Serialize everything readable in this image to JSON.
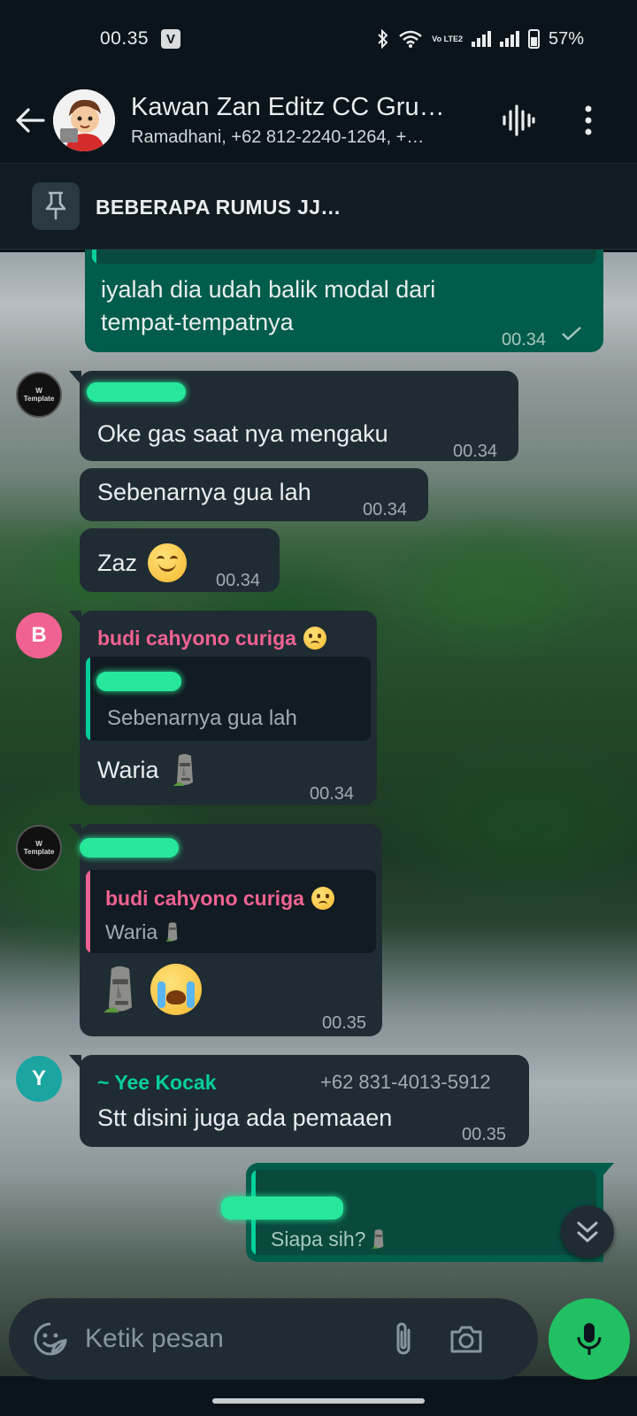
{
  "status": {
    "time": "00.35",
    "app_badge": "V",
    "volte": "Vo LTE2",
    "battery": "57%"
  },
  "header": {
    "title": "Kawan Zan Editz CC Gru…",
    "subtitle": "Ramadhani, +62 812-2240-1264, +…"
  },
  "pinned": {
    "text": "BEBERAPA RUMUS JJ…"
  },
  "messages": {
    "m0": {
      "text1": "iyalah dia udah balik modal dari",
      "text2": "tempat-tempatnya",
      "time": "00.34"
    },
    "m1": {
      "text": "Oke gas saat nya mengaku",
      "time": "00.34"
    },
    "m2": {
      "text": "Sebenarnya gua lah",
      "time": "00.34"
    },
    "m3": {
      "text": "Zaz",
      "time": "00.34"
    },
    "m4": {
      "avatar_letter": "B",
      "sender": "budi cahyono curiga",
      "quote_text": "Sebenarnya gua lah",
      "text": "Waria",
      "time": "00.34"
    },
    "m5": {
      "quote_sender": "budi cahyono curiga",
      "quote_text": "Waria",
      "time": "00.35"
    },
    "m6": {
      "avatar_letter": "Y",
      "sender": "~ Yee Kocak",
      "phone": "+62 831-4013-5912",
      "text": "Stt disini juga ada pemaaen",
      "time": "00.35"
    },
    "m7": {
      "quote_text": "Siapa sih?"
    }
  },
  "composer": {
    "placeholder": "Ketik pesan"
  },
  "colors": {
    "incoming": "#202c33",
    "outgoing": "#005c4b",
    "budi": "#f06292",
    "yee": "#06cf9c",
    "mic": "#21c063"
  },
  "icons": [
    "back-arrow-icon",
    "voice-chat-icon",
    "more-vert-icon",
    "pin-icon",
    "sticker-icon",
    "attach-icon",
    "camera-icon",
    "mic-icon",
    "double-chevron-down-icon",
    "check-icon",
    "wifi-icon",
    "bluetooth-icon"
  ]
}
